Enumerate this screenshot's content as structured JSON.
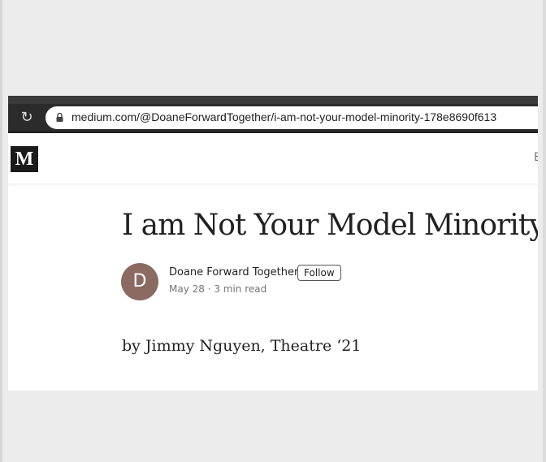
{
  "browser": {
    "url": "medium.com/@DoaneForwardTogether/i-am-not-your-model-minority-178e8690f613"
  },
  "site": {
    "logo_letter": "M",
    "header_right_fragment": "E"
  },
  "article": {
    "title": "I am Not Your Model Minority",
    "author": {
      "name": "Doane Forward Together",
      "avatar_initial": "D",
      "follow_label": "Follow",
      "meta": "May 28 · 3 min read"
    },
    "byline": "by Jimmy Nguyen, Theatre ‘21"
  },
  "colors": {
    "avatar": "#8b6a62",
    "toolbar": "#2b2b2b",
    "logo_bg": "#1a1a1a"
  },
  "icons": {
    "reload": "reload-icon",
    "lock": "lock-icon"
  }
}
